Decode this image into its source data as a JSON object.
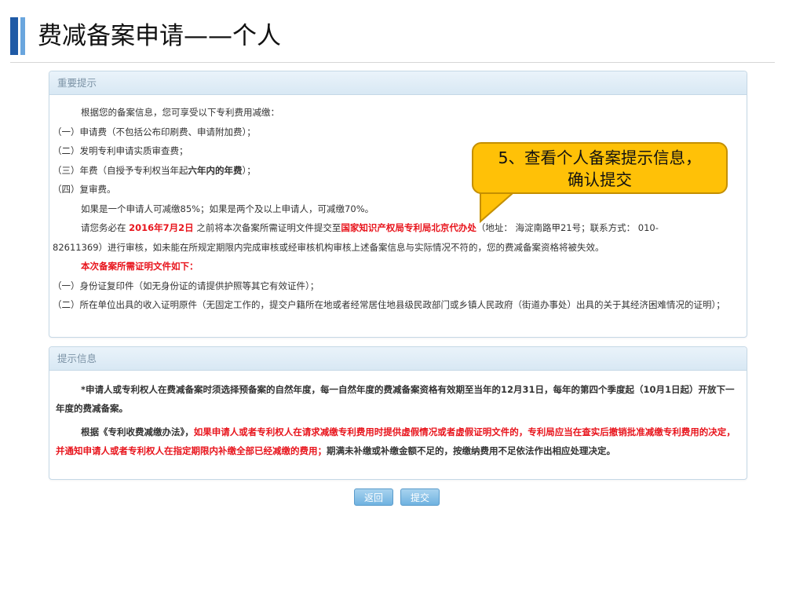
{
  "slide": {
    "title": "费减备案申请——个人"
  },
  "notice_panel": {
    "header": "重要提示",
    "intro": "根据您的备案信息，您可享受以下专利费用减缴：",
    "items": [
      "（一）申请费（不包括公布印刷费、申请附加费）；",
      "（二）发明专利申请实质审查费；",
      "（三）年费（自授予专利权当年起",
      "（四）复审费。"
    ],
    "item3_bold": "六年内的年费",
    "item3_end": "）；",
    "rate_text": "如果是一个申请人可减缴85%；如果是两个及以上申请人，可减缴70%。",
    "deadline_pre": "请您务必在",
    "deadline_date": "2016年7月2日",
    "deadline_mid": "之前将本次备案所需证明文件提交至",
    "deadline_office": "国家知识产权局专利局北京代办处",
    "deadline_post": "（地址：  海淀南路甲21号；联系方式：  010-",
    "deadline_line2": "82611369）进行审核，如未能在所规定期限内完成审核或经审核机构审核上述备案信息与实际情况不符的，您的费减备案资格将被失效。",
    "docs_title": "本次备案所需证明文件如下：",
    "docs": [
      "（一）身份证复印件（如无身份证的请提供护照等其它有效证件）；",
      "（二）所在单位出具的收入证明原件（无固定工作的，提交户籍所在地或者经常居住地县级民政部门或乡镇人民政府（街道办事处）出具的关于其经济困难情况的证明）；"
    ]
  },
  "info_panel": {
    "header": "提示信息",
    "para1": "*申请人或专利权人在费减备案时须选择预备案的自然年度，每一自然年度的费减备案资格有效期至当年的12月31日，每年的第四个季度起（10月1日起）开放下一年度的费减备案。",
    "para2_pre": "根据《专利收费减缴办法》，",
    "para2_red": "如果申请人或者专利权人在请求减缴专利费用时提供虚假情况或者虚假证明文件的，专利局应当在查实后撤销批准减缴专利费用的决定，并通知申请人或者专利权人在指定期限内补缴全部已经减缴的费用；",
    "para2_post": "期满未补缴或补缴金额不足的，按缴纳费用不足依法作出相应处理决定。"
  },
  "callout": {
    "line1": "5、查看个人备案提示信息，",
    "line2": "确认提交"
  },
  "buttons": {
    "back": "返回",
    "submit": "提交"
  },
  "colors": {
    "accent_red": "#e8141c",
    "callout_fill": "#ffc107",
    "button_blue": "#6fb2e0",
    "header_bar": "#1f5aa6"
  }
}
